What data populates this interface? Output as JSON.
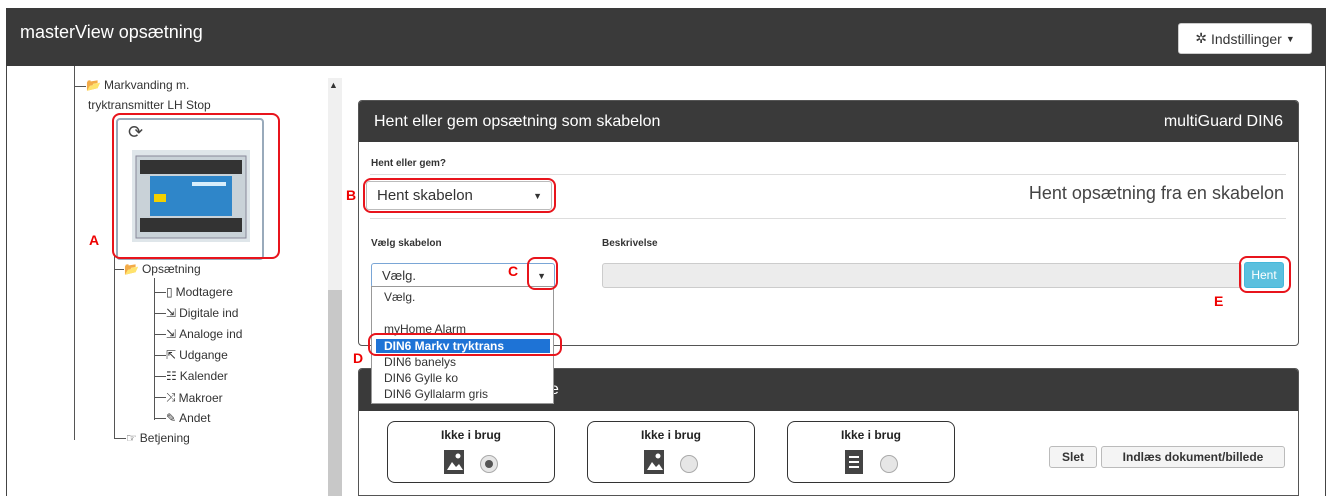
{
  "header": {
    "title": "masterView opsætning",
    "settings_label": "Indstillinger"
  },
  "tree": {
    "parent_line1": "Markvanding m.",
    "parent_line2": "tryktransmitter LH Stop",
    "setup_label": "Opsætning",
    "children": [
      "Modtagere",
      "Digitale ind",
      "Analoge ind",
      "Udgange",
      "Kalender",
      "Makroer",
      "Andet"
    ],
    "operation_label": "Betjening"
  },
  "panel": {
    "title": "Hent eller gem opsætning som skabelon",
    "device": "multiGuard DIN6",
    "load_save_label": "Hent eller gem?",
    "load_save_value": "Hent skabelon",
    "caption": "Hent opsætning fra en skabelon",
    "template_label": "Vælg skabelon",
    "template_value": "Vælg.",
    "description_label": "Beskrivelse",
    "fetch_button": "Hent"
  },
  "dropdown": {
    "options": [
      "Vælg.",
      "",
      "myHome Alarm",
      "DIN6 Markv tryktrans",
      "DIN6 banelys",
      "DIN6 Gylle ko",
      "DIN6 Gyllalarm gris"
    ],
    "selected": "DIN6 Markv tryktrans"
  },
  "panel2": {
    "title_fragment": "e",
    "io_boxes": [
      {
        "label": "Ikke i brug",
        "icon": "image-icon",
        "selected": true
      },
      {
        "label": "Ikke i brug",
        "icon": "image-icon",
        "selected": false
      },
      {
        "label": "Ikke i brug",
        "icon": "document-icon",
        "selected": false
      }
    ],
    "delete_button": "Slet",
    "load_doc_button": "Indlæs dokument/billede"
  },
  "annotations": {
    "a": "A",
    "b": "B",
    "c": "C",
    "d": "D",
    "e": "E"
  },
  "colors": {
    "header_bg": "#3a3a3a",
    "accent_button": "#5bc0de",
    "annotation": "#e8141c",
    "selected_option": "#1e73d6"
  }
}
